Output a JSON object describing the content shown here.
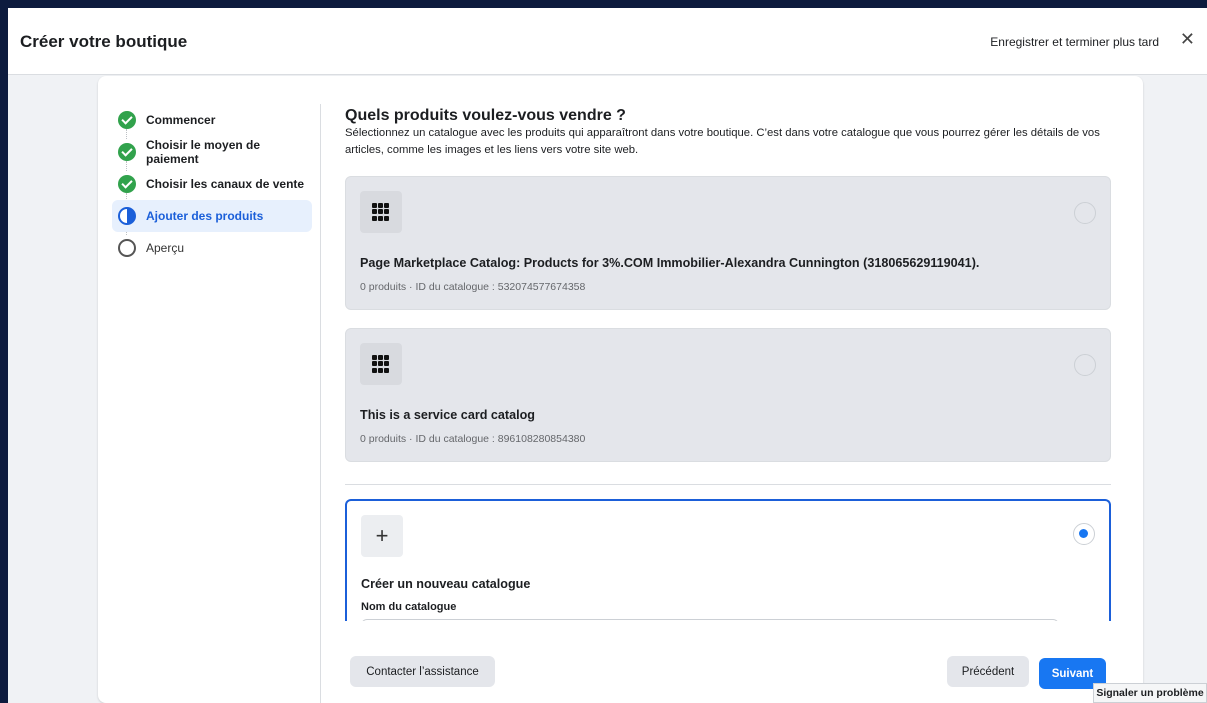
{
  "header": {
    "title": "Créer votre boutique",
    "save_later": "Enregistrer et terminer plus tard",
    "close_glyph": "✕"
  },
  "steps": [
    {
      "label": "Commencer",
      "state": "done"
    },
    {
      "label": "Choisir le moyen de paiement",
      "state": "done"
    },
    {
      "label": "Choisir les canaux de vente",
      "state": "done"
    },
    {
      "label": "Ajouter des produits",
      "state": "current"
    },
    {
      "label": "Aperçu",
      "state": "todo"
    }
  ],
  "main": {
    "heading": "Quels produits voulez-vous vendre ?",
    "description": "Sélectionnez un catalogue avec les produits qui apparaîtront dans votre boutique. C’est dans votre catalogue que vous pourrez gérer les détails de vos articles, comme les images et les liens vers votre site web.",
    "catalogs": [
      {
        "title": "Page Marketplace Catalog: Products for 3%.COM Immobilier-Alexandra Cunnington (318065629119041).",
        "subtitle": "0 produits · ID du catalogue : 532074577674358",
        "selected": false
      },
      {
        "title": "This is a service card catalog",
        "subtitle": "0 produits · ID du catalogue : 896108280854380",
        "selected": false
      }
    ],
    "new_catalog": {
      "plus_glyph": "+",
      "title": "Créer un nouveau catalogue",
      "field_label": "Nom du catalogue",
      "field_value": "",
      "selected": true
    }
  },
  "footer": {
    "contact": "Contacter l’assistance",
    "previous": "Précédent",
    "next": "Suivant"
  },
  "report_problem": "Signaler un problème",
  "colors": {
    "accent": "#1877f2",
    "step_done": "#31a24c",
    "background": "#0d1b3e"
  }
}
